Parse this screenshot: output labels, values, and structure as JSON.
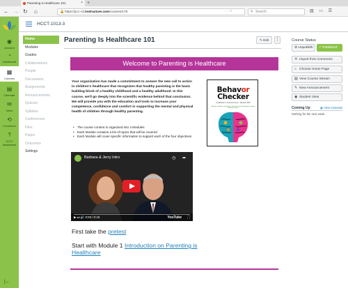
{
  "browser": {
    "tab_title": "Parenting is Healthcare 101",
    "tab_close": "×",
    "new_tab": "+",
    "url_prefix": "https://jccc-cit.",
    "url_domain": "instructure.com",
    "url_path": "/courses/178",
    "search_placeholder": "Search"
  },
  "global_nav": {
    "items": [
      {
        "label": "Account",
        "icon": "account-icon"
      },
      {
        "label": "Dashboard",
        "icon": "dashboard-icon"
      },
      {
        "label": "Courses",
        "icon": "courses-icon"
      },
      {
        "label": "Calendar",
        "icon": "calendar-icon"
      },
      {
        "label": "Inbox",
        "icon": "inbox-icon"
      },
      {
        "label": "Commons",
        "icon": "commons-icon"
      },
      {
        "label": "JCCC Assistance",
        "icon": "help-icon"
      }
    ],
    "collapse": "|←"
  },
  "header": {
    "breadcrumb": "HCCT-1013-3"
  },
  "course_nav": [
    {
      "label": "Home",
      "state": "active"
    },
    {
      "label": "Modules",
      "state": "normal"
    },
    {
      "label": "Grades",
      "state": "normal"
    },
    {
      "label": "Collaborations",
      "state": "dim"
    },
    {
      "label": "People",
      "state": "dim"
    },
    {
      "label": "Discussions",
      "state": "dim"
    },
    {
      "label": "Assignments",
      "state": "dim"
    },
    {
      "label": "Announcements",
      "state": "dim"
    },
    {
      "label": "Quizzes",
      "state": "dim"
    },
    {
      "label": "Syllabus",
      "state": "dim"
    },
    {
      "label": "Conferences",
      "state": "dim"
    },
    {
      "label": "Files",
      "state": "dim"
    },
    {
      "label": "Pages",
      "state": "dim"
    },
    {
      "label": "Outcomes",
      "state": "dim"
    },
    {
      "label": "Settings",
      "state": "normal"
    }
  ],
  "page": {
    "title": "Parenting Is Healthcare 101",
    "edit_label": "✎ Edit",
    "more_label": "⋮",
    "banner": "Welcome to Parenting is Healthcare",
    "intro": "Your organization has made a commitment to answer the new call to action in children's healthcare that recognizes that healthy parenting is the basic building block of a healthy childhood and a healthy adulthood. In this course, we'll go deeply into the scientific evidence behind that conclusion.  We will provide you with the education and tools to increase your competence, confidence and comfort in supporting the mental and physical health of children through healthy parenting.",
    "bullets": [
      "The course content is organized into 4 Modules",
      "Each Module contains a list of topics that will be covered",
      "Each Module will cover specific information to support each of the four objectives"
    ],
    "book": {
      "title_a": "Behav",
      "title_b": "or",
      "title_c": "Checker",
      "authors": "by Barbara C. Greif and Jerry L. Wyckoff, PhD",
      "subtitle": "Reliable Guidance and Smart Strategies for Navigating Common Behavior Issues"
    },
    "video": {
      "title": "Barbara & Jerry Intro",
      "time": "0:00 / 0:19",
      "youtube": "YouTube"
    },
    "line1_prefix": "First take the ",
    "line1_link": "pretest",
    "line2_prefix": "Start with Module 1 ",
    "line2_link": "Introduction on Parenting is Healthcare"
  },
  "sidebar": {
    "status_heading": "Course Status",
    "unpublish": "⊘ Unpublish",
    "published": "✓ Published",
    "buttons": [
      {
        "label": "Import from Commons",
        "icon": "⟲"
      },
      {
        "label": "Choose Home Page",
        "icon": "⌂"
      },
      {
        "label": "View Course Stream",
        "icon": "▤"
      },
      {
        "label": "New Announcement",
        "icon": "✎"
      },
      {
        "label": "Student View",
        "icon": "◉"
      }
    ],
    "coming_up": "Coming Up",
    "view_calendar": "▦ View Calendar",
    "nothing": "Nothing for the next week"
  },
  "colors": {
    "brand_green": "#8bc34a",
    "banner_magenta": "#b5349a",
    "link_blue": "#1e7fb8"
  }
}
